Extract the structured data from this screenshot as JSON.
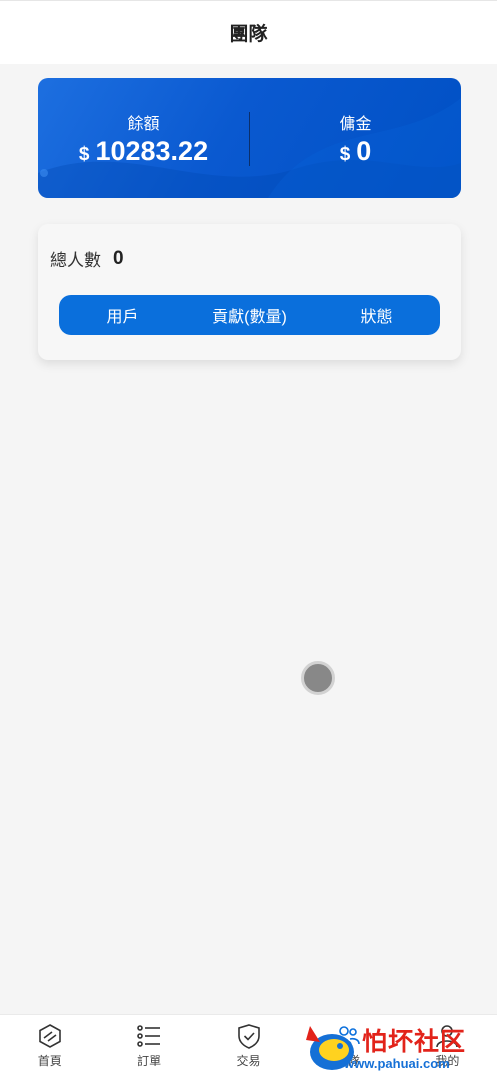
{
  "header": {
    "title": "團隊"
  },
  "balance": {
    "balance_label": "餘額",
    "balance_currency": "$",
    "balance_value": "10283.22",
    "commission_label": "傭金",
    "commission_currency": "$",
    "commission_value": "0"
  },
  "team": {
    "total_label": "總人數",
    "total_value": "0",
    "columns": [
      "用戶",
      "貢獻(數量)",
      "狀態"
    ]
  },
  "tabbar": {
    "items": [
      {
        "label": "首頁",
        "icon": "home-cube-icon"
      },
      {
        "label": "訂單",
        "icon": "list-icon"
      },
      {
        "label": "交易",
        "icon": "shield-check-icon"
      },
      {
        "label": "團隊",
        "icon": "team-icon"
      },
      {
        "label": "我的",
        "icon": "user-icon"
      }
    ]
  },
  "watermark": {
    "text": "怕坏社区",
    "url": "www.pahuai.com"
  },
  "colors": {
    "primary": "#0a6fdc",
    "card_gradient_start": "#1d6fe0",
    "card_gradient_end": "#0050c4",
    "background": "#f5f5f5"
  }
}
